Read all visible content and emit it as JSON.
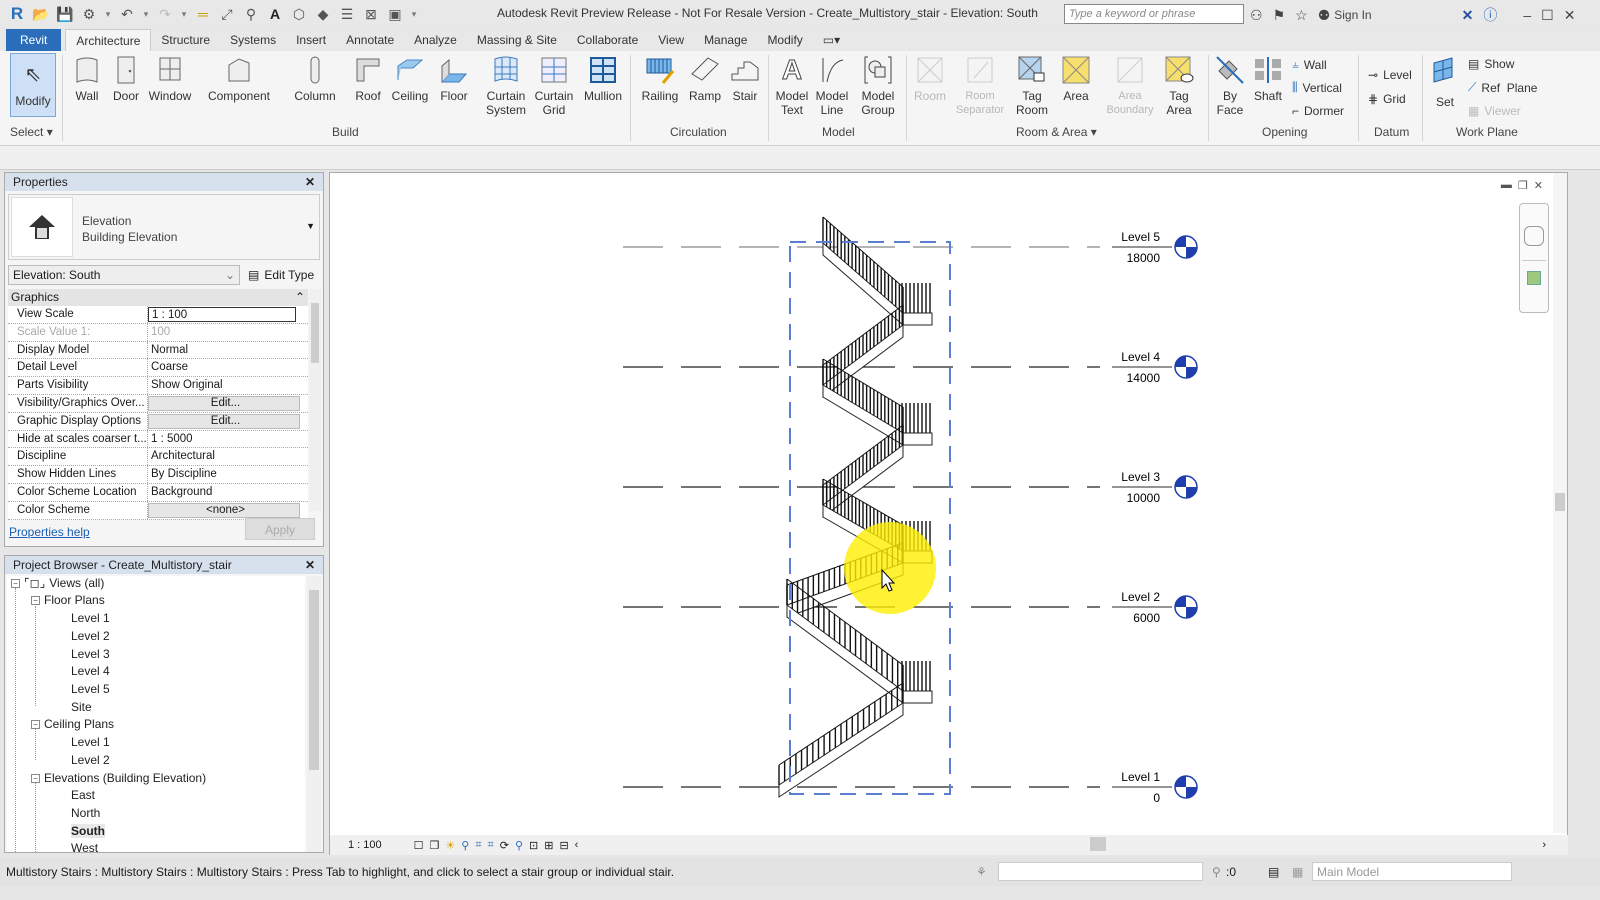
{
  "titlebar": {
    "title": "Autodesk Revit Preview Release - Not For Resale Version -     Create_Multistory_stair - Elevation: South",
    "search_placeholder": "Type a keyword or phrase",
    "sign_in": "Sign In"
  },
  "tabs": [
    "Revit",
    "Architecture",
    "Structure",
    "Systems",
    "Insert",
    "Annotate",
    "Analyze",
    "Massing & Site",
    "Collaborate",
    "View",
    "Manage",
    "Modify"
  ],
  "ribbon": {
    "select": {
      "modify": "Modify",
      "label": "Select"
    },
    "build": {
      "label": "Build",
      "items": [
        "Wall",
        "Door",
        "Window",
        "Component",
        "Column",
        "Roof",
        "Ceiling",
        "Floor",
        "Curtain System",
        "Curtain Grid",
        "Mullion"
      ]
    },
    "circulation": {
      "label": "Circulation",
      "items": [
        "Railing",
        "Ramp",
        "Stair"
      ]
    },
    "model": {
      "label": "Model",
      "items": [
        "Model Text",
        "Model Line",
        "Model Group"
      ]
    },
    "room_area": {
      "label": "Room & Area",
      "items": [
        "Room",
        "Room Separator",
        "Tag Room",
        "Area",
        "Area Boundary",
        "Tag Area"
      ]
    },
    "opening": {
      "label": "Opening",
      "items": [
        "By Face",
        "Shaft"
      ],
      "small": [
        "Wall",
        "Vertical",
        "Dormer"
      ]
    },
    "datum": {
      "label": "Datum",
      "small": [
        "Level",
        "Grid"
      ]
    },
    "work_plane": {
      "label": "Work Plane",
      "set": "Set",
      "small": [
        "Show",
        "Ref  Plane",
        "Viewer"
      ]
    }
  },
  "properties": {
    "title": "Properties",
    "type_line1": "Elevation",
    "type_line2": "Building Elevation",
    "instance": "Elevation: South",
    "edit_type": "Edit Type",
    "group": "Graphics",
    "rows": [
      {
        "k": "View Scale",
        "v": "1 : 100"
      },
      {
        "k": "Scale Value    1:",
        "v": "100"
      },
      {
        "k": "Display Model",
        "v": "Normal"
      },
      {
        "k": "Detail Level",
        "v": "Coarse"
      },
      {
        "k": "Parts Visibility",
        "v": "Show Original"
      },
      {
        "k": "Visibility/Graphics Over...",
        "v": "Edit..."
      },
      {
        "k": "Graphic Display Options",
        "v": "Edit..."
      },
      {
        "k": "Hide at scales coarser t...",
        "v": "1 : 5000"
      },
      {
        "k": "Discipline",
        "v": "Architectural"
      },
      {
        "k": "Show Hidden Lines",
        "v": "By Discipline"
      },
      {
        "k": "Color Scheme Location",
        "v": "Background"
      },
      {
        "k": "Color Scheme",
        "v": "<none>"
      }
    ],
    "help": "Properties help",
    "apply": "Apply"
  },
  "browser": {
    "title": "Project Browser - Create_Multistory_stair",
    "root": "Views (all)",
    "floor_plans": "Floor Plans",
    "floor_items": [
      "Level 1",
      "Level 2",
      "Level 3",
      "Level 4",
      "Level 5",
      "Site"
    ],
    "ceiling_plans": "Ceiling Plans",
    "ceiling_items": [
      "Level 1",
      "Level 2"
    ],
    "elevations": "Elevations (Building Elevation)",
    "elevation_items": [
      "East",
      "North",
      "South",
      "West"
    ]
  },
  "levels": [
    {
      "name": "Level 5",
      "elev": "18000"
    },
    {
      "name": "Level 4",
      "elev": "14000"
    },
    {
      "name": "Level 3",
      "elev": "10000"
    },
    {
      "name": "Level 2",
      "elev": "6000"
    },
    {
      "name": "Level 1",
      "elev": "0"
    }
  ],
  "view_bar": {
    "scale": "1 : 100"
  },
  "status": {
    "message": "Multistory Stairs : Multistory Stairs : Multistory Stairs : Press Tab to highlight, and click to select a stair group or individual stair.",
    "selection_count": ":0",
    "model": "Main Model"
  },
  "colors": {
    "accent": "#2a6ebb",
    "level_head": "#1f3fae",
    "crop": "#5a7fd0",
    "highlight": "#ffee00"
  }
}
